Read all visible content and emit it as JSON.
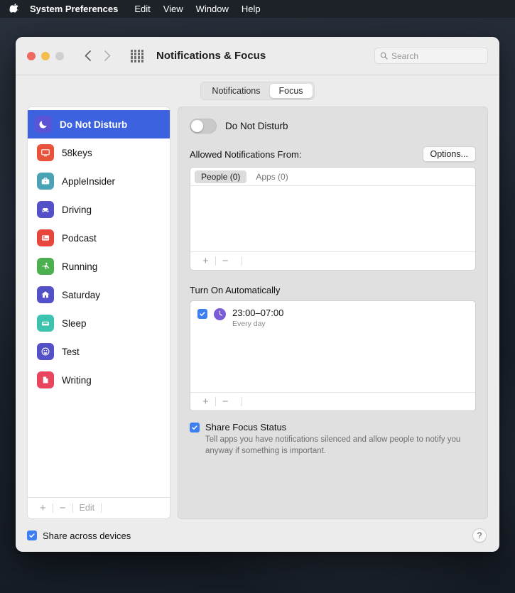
{
  "menubar": {
    "apple_icon": "apple-logo-icon",
    "items": [
      {
        "label": "System Preferences",
        "bold": true
      },
      {
        "label": "Edit",
        "bold": false
      },
      {
        "label": "View",
        "bold": false
      },
      {
        "label": "Window",
        "bold": false
      },
      {
        "label": "Help",
        "bold": false
      }
    ]
  },
  "window": {
    "title": "Notifications & Focus",
    "traffic_lights": [
      "close-red",
      "minimize-yellow",
      "zoom-gray"
    ],
    "back_icon": "chevron-left-icon",
    "forward_icon": "chevron-right-icon",
    "grid_icon": "show-all-grid-icon",
    "search": {
      "icon": "search-icon",
      "placeholder": "Search",
      "value": ""
    }
  },
  "tabs": [
    {
      "label": "Notifications",
      "active": false
    },
    {
      "label": "Focus",
      "active": true
    }
  ],
  "sidebar": {
    "items": [
      {
        "label": "Do Not Disturb",
        "icon": "moon-icon",
        "color": "#5b54d6",
        "selected": true
      },
      {
        "label": "58keys",
        "icon": "display-icon",
        "color": "#e8513a",
        "selected": false
      },
      {
        "label": "AppleInsider",
        "icon": "briefcase-icon",
        "color": "#4aa3b5",
        "selected": false
      },
      {
        "label": "Driving",
        "icon": "car-icon",
        "color": "#5350c8",
        "selected": false
      },
      {
        "label": "Podcast",
        "icon": "podcast-icon",
        "color": "#e8463c",
        "selected": false
      },
      {
        "label": "Running",
        "icon": "runner-icon",
        "color": "#4cb050",
        "selected": false
      },
      {
        "label": "Saturday",
        "icon": "house-icon",
        "color": "#5350c8",
        "selected": false
      },
      {
        "label": "Sleep",
        "icon": "bed-icon",
        "color": "#3cc3ae",
        "selected": false
      },
      {
        "label": "Test",
        "icon": "smiley-icon",
        "color": "#5350c8",
        "selected": false
      },
      {
        "label": "Writing",
        "icon": "document-icon",
        "color": "#e8455e",
        "selected": false
      }
    ],
    "footer": {
      "add_label": "+",
      "remove_label": "−",
      "edit_label": "Edit"
    }
  },
  "main": {
    "dnd_toggle": {
      "label": "Do Not Disturb",
      "state": "off"
    },
    "allowed": {
      "title": "Allowed Notifications From:",
      "options_button": "Options...",
      "tabs": [
        {
          "label": "People (0)",
          "active": true
        },
        {
          "label": "Apps (0)",
          "active": false
        }
      ],
      "footer": {
        "add_label": "+",
        "remove_label": "−"
      }
    },
    "schedule": {
      "title": "Turn On Automatically",
      "entries": [
        {
          "checked": true,
          "icon": "clock-icon",
          "time": "23:00–07:00",
          "repeat": "Every day"
        }
      ],
      "footer": {
        "add_label": "+",
        "remove_label": "−"
      }
    },
    "share_focus": {
      "checked": true,
      "title": "Share Focus Status",
      "description": "Tell apps you have notifications silenced and allow people to notify you anyway if something is important."
    }
  },
  "footer": {
    "share_across_devices": {
      "checked": true,
      "label": "Share across devices"
    },
    "help_label": "?",
    "help_icon": "help-question-icon"
  },
  "colors": {
    "accent_blue": "#3d62e0",
    "checkbox_blue": "#3d7ef0",
    "menubar_bg": "#1d2229",
    "window_bg": "#ececec",
    "panel_bg": "#e0e0e0"
  }
}
